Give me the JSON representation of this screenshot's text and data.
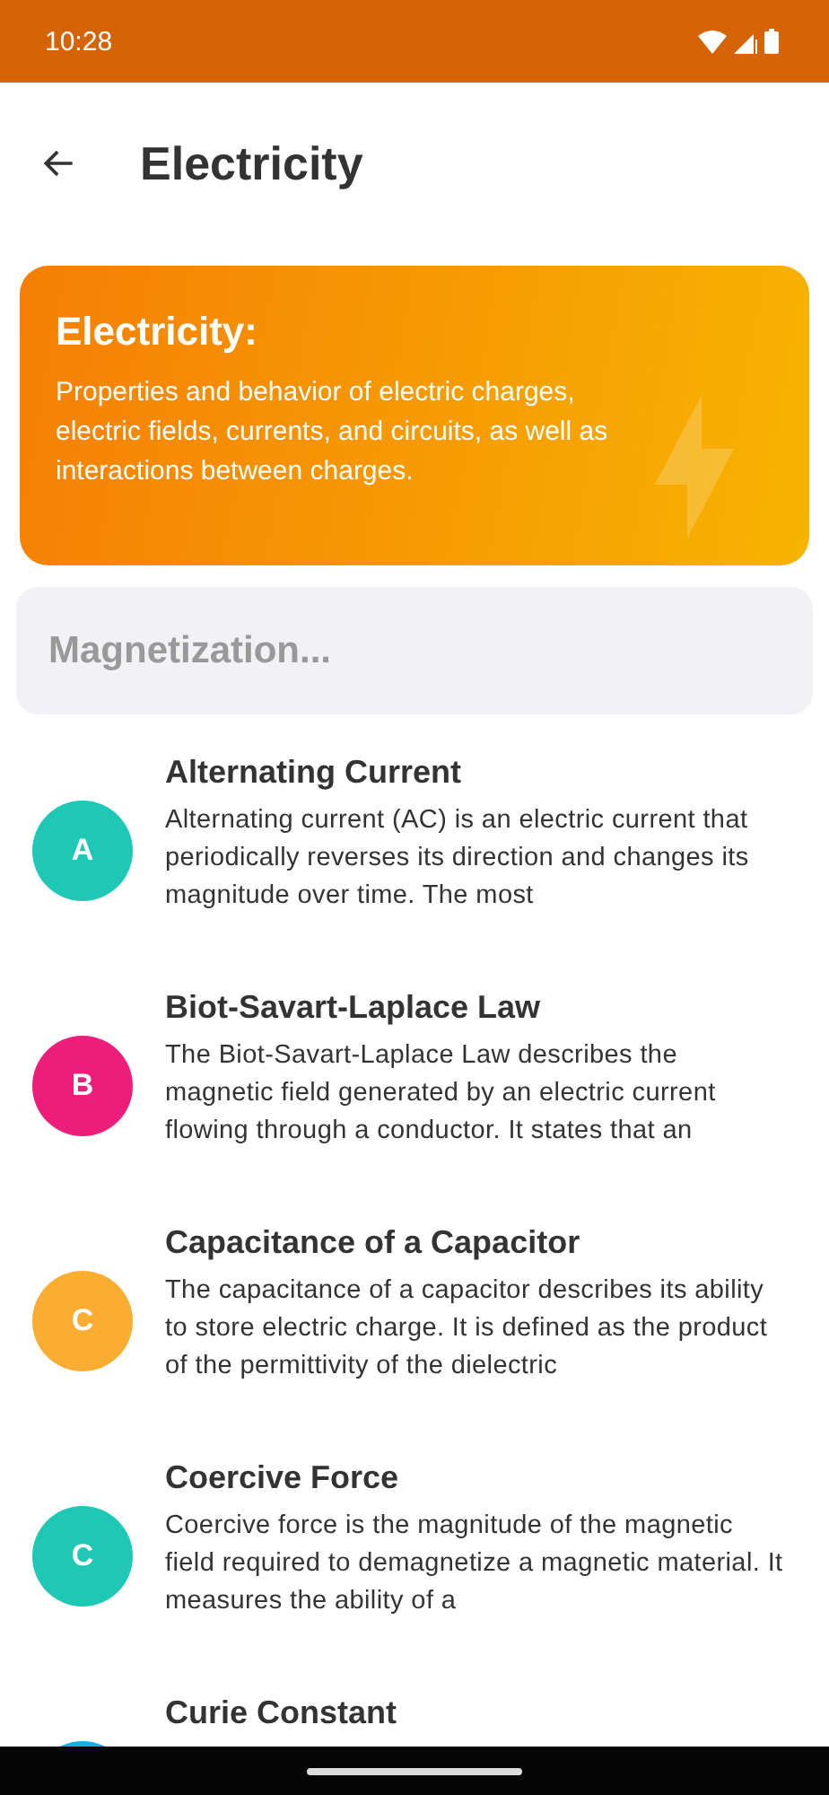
{
  "status_bar": {
    "time": "10:28"
  },
  "app_bar": {
    "title": "Electricity"
  },
  "header_card": {
    "title": "Electricity:",
    "description": "Properties and behavior of electric charges, electric fields, currents, and circuits, as well as interactions between charges."
  },
  "search": {
    "placeholder": "Magnetization..."
  },
  "topics": [
    {
      "letter": "A",
      "color": "#1ec8b4",
      "title": "Alternating Current",
      "description": "Alternating current (AC) is an electric current that periodically reverses its direction and changes its magnitude over time. The most"
    },
    {
      "letter": "B",
      "color": "#ec1e79",
      "title": "Biot-Savart-Laplace Law",
      "description": "The Biot-Savart-Laplace Law describes the magnetic field generated by an electric current flowing through a conductor. It states that an"
    },
    {
      "letter": "C",
      "color": "#fbad32",
      "title": "Capacitance of a Capacitor",
      "description": "The capacitance of a capacitor describes its ability to store electric charge. It is defined as the product of the permittivity of the dielectric"
    },
    {
      "letter": "C",
      "color": "#1ec8b4",
      "title": "Coercive Force",
      "description": "Coercive force is the magnitude of the magnetic field required to demagnetize a magnetic material. It measures the ability of a"
    },
    {
      "color": "#12aee8",
      "title": "Curie Constant"
    }
  ]
}
